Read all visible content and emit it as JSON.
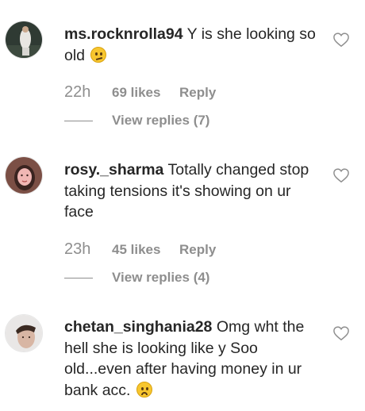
{
  "comments": [
    {
      "username": "ms.rocknrolla94",
      "text": "Y is she looking so old",
      "emoji": "thinking-face-emoji",
      "time": "22h",
      "likes": "69 likes",
      "reply_label": "Reply",
      "view_replies": "View replies (7)"
    },
    {
      "username": "rosy._sharma",
      "text": "Totally changed stop taking tensions it's showing on ur face",
      "time": "23h",
      "likes": "45 likes",
      "reply_label": "Reply",
      "view_replies": "View replies (4)"
    },
    {
      "username": "chetan_singhania28",
      "text": "Omg wht the hell she is looking like y Soo old...even after having money in ur bank acc.",
      "emoji": "frowning-face-emoji"
    }
  ],
  "colors": {
    "text": "#262626",
    "secondary": "#8e8e8e",
    "emoji": "#f7c62f"
  }
}
